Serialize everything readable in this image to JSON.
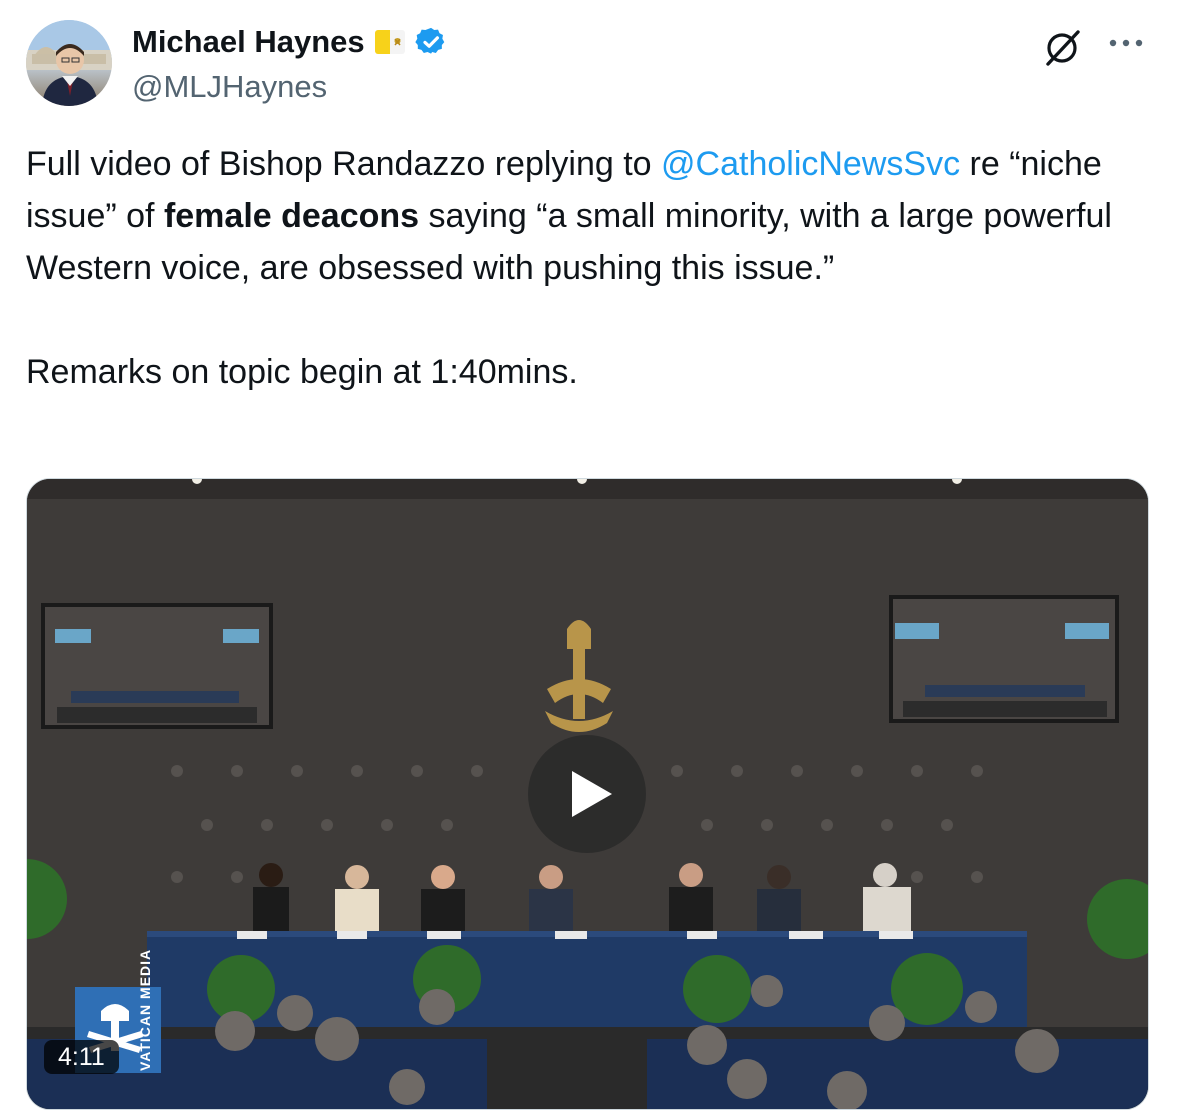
{
  "author": {
    "display_name": "Michael Haynes",
    "handle": "@MLJHaynes",
    "flag_icon": "vatican-flag-icon",
    "verified_icon": "verified-badge-icon",
    "verified_color": "#1d9bf0"
  },
  "actions": {
    "grok_icon": "grok-icon",
    "more_icon": "more-horizontal-icon"
  },
  "tweet": {
    "part1": "Full video of Bishop Randazzo replying to ",
    "mention": "@CatholicNewsSvc",
    "part2": " re “niche issue” of ",
    "bold": "female deacons",
    "part3": " saying “a small minority, with a large powerful Western voice, are obsessed with pushing this issue.”\n\nRemarks on topic begin at 1:40mins.",
    "mention_color": "#1d9bf0"
  },
  "media": {
    "play_icon": "play-icon",
    "duration": "4:11",
    "watermark_logo": "vatican-media-logo",
    "watermark_text": "VATICAN MEDIA"
  }
}
